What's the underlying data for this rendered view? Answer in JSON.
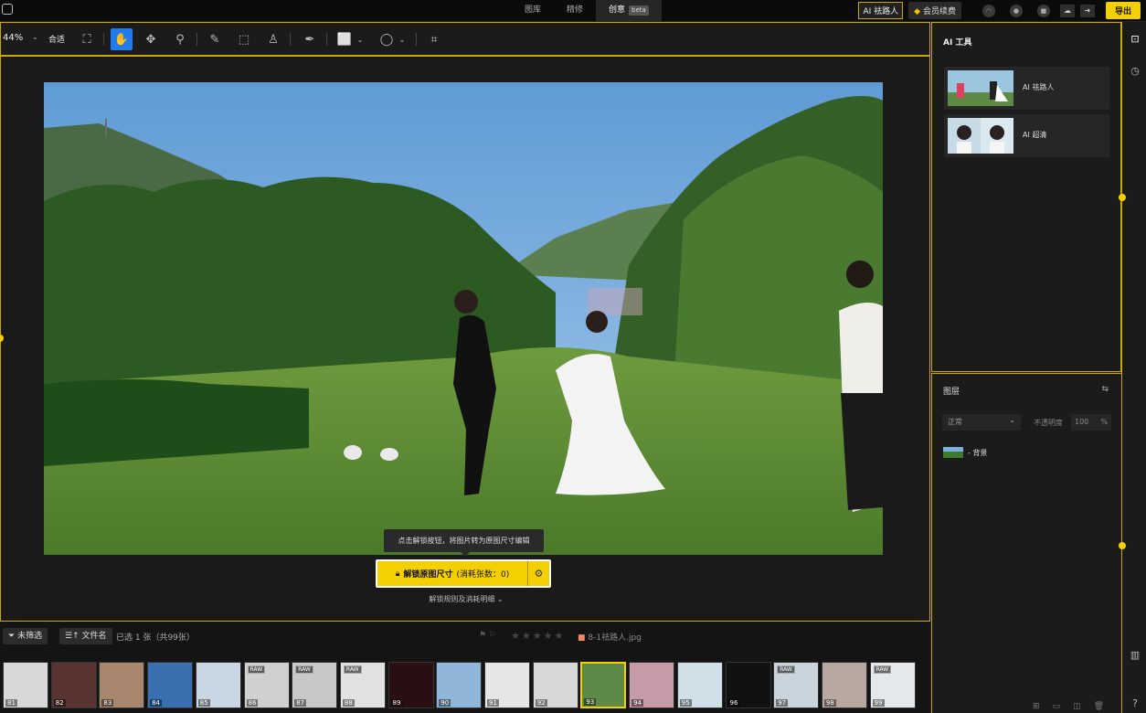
{
  "topbar": {
    "tabs": [
      {
        "label": "图库"
      },
      {
        "label": "精修"
      },
      {
        "label": "创意",
        "badge": "beta"
      }
    ],
    "ai_remove_label": "AI 祛路人",
    "vip_label": "会员续费",
    "export_label": "导出"
  },
  "toolbar": {
    "zoom": "44%",
    "fit_label": "合适"
  },
  "canvas": {
    "tooltip": "点击解锁按钮，将图片转为原图尺寸编辑",
    "unlock_label": "解锁原图尺寸",
    "unlock_cost": "(消耗张数：0)",
    "rules_link": "解锁规则及消耗明细 ⌄"
  },
  "filter": {
    "unfiltered_label": "未筛选",
    "sort_label": "文件名",
    "selected_text": "已选 1 张（共99张）",
    "filename": "8-1祛路人.jpg"
  },
  "filmstrip": {
    "thumbs": [
      {
        "num": "81",
        "raw": false,
        "color": "#d8d8d8"
      },
      {
        "num": "82",
        "raw": false,
        "color": "#5a3430"
      },
      {
        "num": "83",
        "raw": false,
        "color": "#a8876e"
      },
      {
        "num": "84",
        "raw": false,
        "color": "#3a6fb0"
      },
      {
        "num": "85",
        "raw": false,
        "color": "#c9d6e4"
      },
      {
        "num": "86",
        "raw": true,
        "color": "#d0d0d0"
      },
      {
        "num": "87",
        "raw": true,
        "color": "#c8c8c8"
      },
      {
        "num": "88",
        "raw": true,
        "color": "#e2e2e2"
      },
      {
        "num": "89",
        "raw": false,
        "color": "#2a0f12"
      },
      {
        "num": "90",
        "raw": false,
        "color": "#8fb5d8"
      },
      {
        "num": "91",
        "raw": false,
        "color": "#e6e6e6"
      },
      {
        "num": "92",
        "raw": false,
        "color": "#d8d8d8"
      },
      {
        "num": "93",
        "raw": false,
        "color": "#5e8a48",
        "selected": true
      },
      {
        "num": "94",
        "raw": false,
        "color": "#c79aa8"
      },
      {
        "num": "95",
        "raw": false,
        "color": "#cfe0e8"
      },
      {
        "num": "96",
        "raw": false,
        "color": "#111111"
      },
      {
        "num": "97",
        "raw": true,
        "color": "#c9d4dc"
      },
      {
        "num": "98",
        "raw": false,
        "color": "#b8a8a0"
      },
      {
        "num": "99",
        "raw": true,
        "color": "#e4e8ea"
      }
    ]
  },
  "ai_tools": {
    "title": "AI 工具",
    "items": [
      {
        "label": "AI 祛路人"
      },
      {
        "label": "AI 超清"
      }
    ]
  },
  "layers": {
    "title": "图层",
    "blend_mode": "正常",
    "opacity_label": "不透明度",
    "opacity_value": "100",
    "opacity_unit": "%",
    "items": [
      {
        "label": "- 背景"
      }
    ]
  },
  "colors": {
    "accent": "#f5d000",
    "active_tool": "#1e7cf0",
    "panel_border": "#c9a800"
  }
}
